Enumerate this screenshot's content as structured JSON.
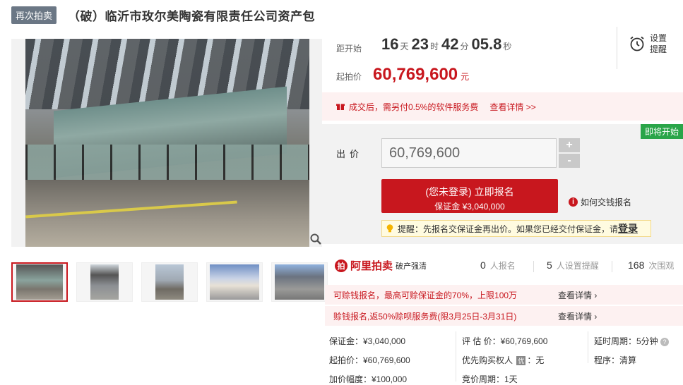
{
  "header": {
    "badge": "再次拍卖",
    "title": "（破）临沂市玫尔美陶瓷有限责任公司资产包"
  },
  "countdown": {
    "label": "距开始",
    "days": "16",
    "days_unit": "天",
    "hours": "23",
    "hours_unit": "时",
    "minutes": "42",
    "minutes_unit": "分",
    "seconds": "05.8",
    "seconds_unit": "秒"
  },
  "reminder": {
    "line1": "设置",
    "line2": "提醒"
  },
  "start_price": {
    "label": "起拍价",
    "value": "60,769,600",
    "unit": "元"
  },
  "fee_notice": {
    "text": "成交后，需另付0.5%的软件服务费",
    "link": "查看详情 >>"
  },
  "bid": {
    "soon_badge": "即将开始",
    "label": "出价",
    "value": "60,769,600",
    "plus": "+",
    "minus": "-",
    "signup_main": "(您未登录) 立即报名",
    "signup_sub": "保证金 ¥3,040,000",
    "howto": "如何交钱报名",
    "tip_text": "提醒：先报名交保证金再出价。如果您已经交付保证金，请",
    "tip_link": "登录"
  },
  "brand": {
    "name": "阿里拍卖",
    "tag": "破产强清"
  },
  "stats": [
    {
      "num": "0",
      "label": "人报名"
    },
    {
      "num": "5",
      "label": "人设置提醒"
    },
    {
      "num": "168",
      "label": "次围观"
    }
  ],
  "promos": [
    {
      "text": "可赊钱报名，最高可赊保证金的70%，上限100万",
      "link": "查看详情"
    },
    {
      "text": "赊钱报名,返50%赊呗服务费(限3月25日-3月31日)",
      "link": "查看详情"
    }
  ],
  "details": {
    "deposit": "保证金：¥3,040,000",
    "start": "起拍价：¥60,769,600",
    "increment": "加价幅度：¥100,000",
    "appraisal": "评 估 价：¥60,769,600",
    "priority_label": "优先购买权人",
    "priority_value": "无",
    "bid_period": "竞价周期：1天",
    "delay_period": "延时周期：5分钟",
    "procedure": "程序：清算"
  },
  "colors": {
    "accent": "#c8171e",
    "badge_bg": "#6b7785",
    "soon_green": "#2aa549"
  },
  "icons": [
    "zoom-icon",
    "alarm-clock-icon",
    "gift-icon",
    "info-icon",
    "lightbulb-icon",
    "help-icon"
  ]
}
